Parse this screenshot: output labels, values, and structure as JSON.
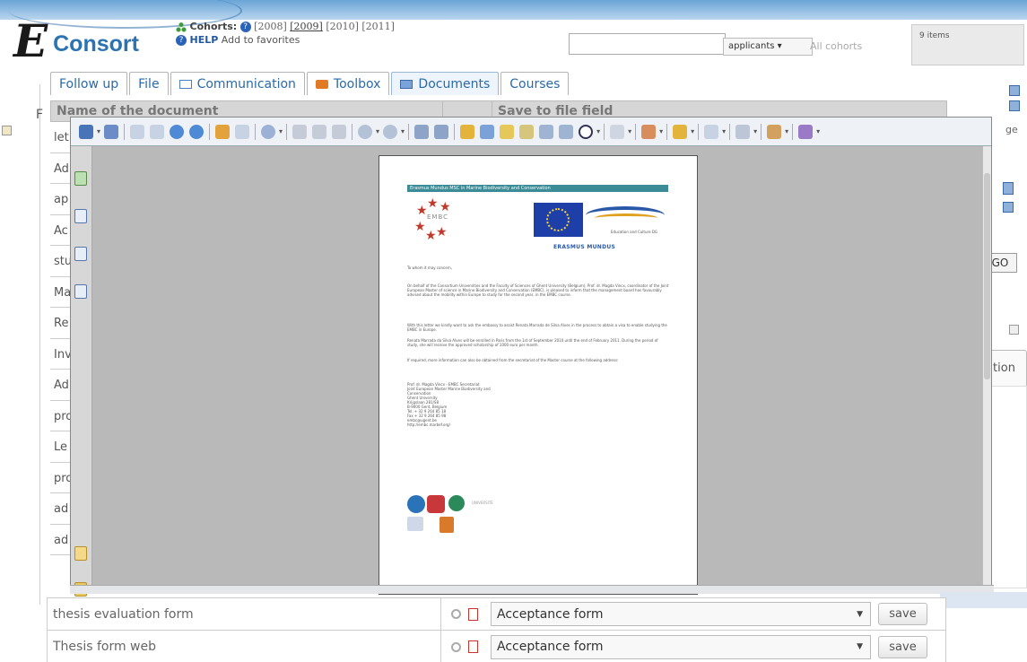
{
  "header": {
    "logo_letter": "E",
    "logo_word": "Consort",
    "cohorts_label": "Cohorts:",
    "years": [
      "[2008]",
      "[2009]",
      "[2010]",
      "[2011]"
    ],
    "help_label": "HELP",
    "favorites_link": "Add to favorites",
    "search": {
      "value": "",
      "placeholder": ""
    },
    "search_scope": "applicants",
    "all_cohorts": "All cohorts",
    "items_count": "9 items"
  },
  "tabs": [
    {
      "label": "Follow up"
    },
    {
      "label": "File"
    },
    {
      "label": "Communication"
    },
    {
      "label": "Toolbox"
    },
    {
      "label": "Documents"
    },
    {
      "label": "Courses"
    }
  ],
  "table": {
    "col_name": "Name of the document",
    "col_save": "Save to file field",
    "left_rows": [
      "let",
      "Ad",
      "ap",
      "Ac",
      "stu",
      "Ma",
      "Re",
      "Inv",
      "Ad",
      "pro",
      "Le",
      "pro",
      "ad",
      "ad"
    ],
    "bottom_rows": [
      {
        "name": "thesis evaluation form",
        "field": "Acceptance form",
        "save": "save"
      },
      {
        "name": "Thesis form web",
        "field": "Acceptance form",
        "save": "save"
      }
    ]
  },
  "side": {
    "left_letter": "F",
    "go_button": "GO",
    "partial_button": "tion",
    "partial_text": "ge"
  },
  "pdf": {
    "banner": "Erasmus Mundus MSC in Marine Biodiversity and Conservation",
    "embc_text": "EMBC",
    "edu_text": "Education and Culture DG",
    "mundus_text": "ERASMUS MUNDUS",
    "greeting": "To whom it may concern,",
    "para1": "On behalf of the Consortium Universities and the Faculty of Sciences of Ghent University (Belgium), Prof. dr. Magda Vincx, coordinator of the Joint European Master of science in Marine Biodiversity and Conservation (EMBC), is pleased to inform that the management board has favourably advised about the mobility within Europe to study for the second year, in the EMBC course.",
    "para2": "With this letter we kindly want to ask the embassy to assist Renata Marrada de Silva Alves in the process to obtain a visa to enable studying the EMBC in Europe.",
    "para3": "Renata Marrada da Silva Alves will be enrolled in Paris from the 1st of September 2010 until the end of February 2011. During the period of study, she will receive the approved scholarship of 1000 euro per month.",
    "para4": "If required, more information can also be obtained from the secretariat of the Master course at the following address:",
    "address": [
      "Prof. dr. Magda Vincx - EMBC Secretariat",
      "Joint European Master Marine Biodiversity and",
      "Conservation",
      "Ghent University",
      "Krijgslaan 281/S8",
      "B-9000 Gent, Belgium",
      "Tel. + 32 9 264 85 18",
      "Fax + 32 9 264 85 98",
      "embc@ugent.be",
      "http://embc.marbef.org/"
    ],
    "partner_text": "UNIVERSITE"
  }
}
